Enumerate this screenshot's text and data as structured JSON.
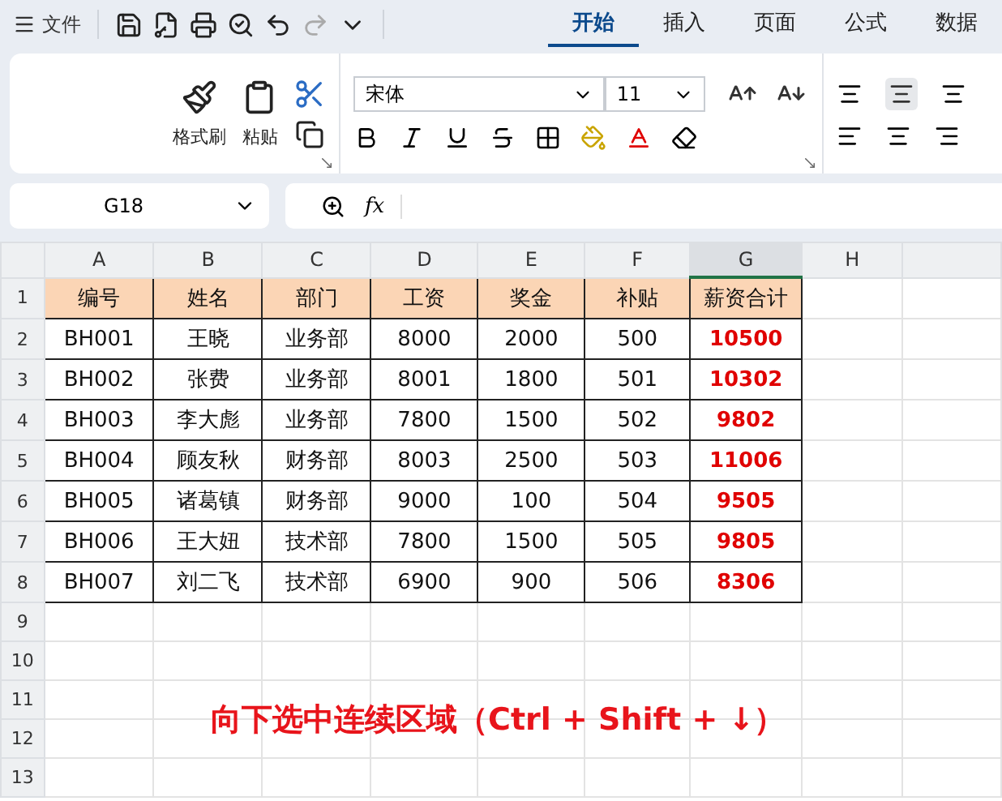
{
  "file_menu": {
    "label": "文件"
  },
  "tabs": [
    {
      "label": "开始",
      "selected": true
    },
    {
      "label": "插入",
      "selected": false
    },
    {
      "label": "页面",
      "selected": false
    },
    {
      "label": "公式",
      "selected": false
    },
    {
      "label": "数据",
      "selected": false
    }
  ],
  "ribbon": {
    "format_painter": "格式刷",
    "paste": "粘贴",
    "font_name": "宋体",
    "font_size": "11"
  },
  "name_box": "G18",
  "formula_label": "fx",
  "sheet": {
    "columns": [
      {
        "label": "A",
        "selected": false
      },
      {
        "label": "B",
        "selected": false
      },
      {
        "label": "C",
        "selected": false
      },
      {
        "label": "D",
        "selected": false
      },
      {
        "label": "E",
        "selected": false
      },
      {
        "label": "F",
        "selected": false
      },
      {
        "label": "G",
        "selected": true
      },
      {
        "label": "H",
        "selected": false
      }
    ],
    "rows": [
      {
        "number": "1",
        "kind": "header",
        "cells": [
          "编号",
          "姓名",
          "部门",
          "工资",
          "奖金",
          "补贴",
          "薪资合计"
        ]
      },
      {
        "number": "2",
        "kind": "data",
        "cells": [
          "BH001",
          "王晓",
          "业务部",
          "8000",
          "2000",
          "500",
          "10500"
        ]
      },
      {
        "number": "3",
        "kind": "data",
        "cells": [
          "BH002",
          "张费",
          "业务部",
          "8001",
          "1800",
          "501",
          "10302"
        ]
      },
      {
        "number": "4",
        "kind": "data",
        "cells": [
          "BH003",
          "李大彪",
          "业务部",
          "7800",
          "1500",
          "502",
          "9802"
        ]
      },
      {
        "number": "5",
        "kind": "data",
        "cells": [
          "BH004",
          "顾友秋",
          "财务部",
          "8003",
          "2500",
          "503",
          "11006"
        ]
      },
      {
        "number": "6",
        "kind": "data",
        "cells": [
          "BH005",
          "诸葛镇",
          "财务部",
          "9000",
          "100",
          "504",
          "9505"
        ]
      },
      {
        "number": "7",
        "kind": "data",
        "cells": [
          "BH006",
          "王大妞",
          "技术部",
          "7800",
          "1500",
          "505",
          "9805"
        ]
      },
      {
        "number": "8",
        "kind": "data",
        "cells": [
          "BH007",
          "刘二飞",
          "技术部",
          "6900",
          "900",
          "506",
          "8306"
        ]
      },
      {
        "number": "9",
        "kind": "empty",
        "cells": []
      },
      {
        "number": "10",
        "kind": "empty",
        "cells": []
      },
      {
        "number": "11",
        "kind": "empty",
        "cells": []
      },
      {
        "number": "12",
        "kind": "empty",
        "cells": []
      },
      {
        "number": "13",
        "kind": "empty",
        "cells": []
      }
    ]
  },
  "caption": "向下选中连续区域（Ctrl + Shift + ↓）"
}
